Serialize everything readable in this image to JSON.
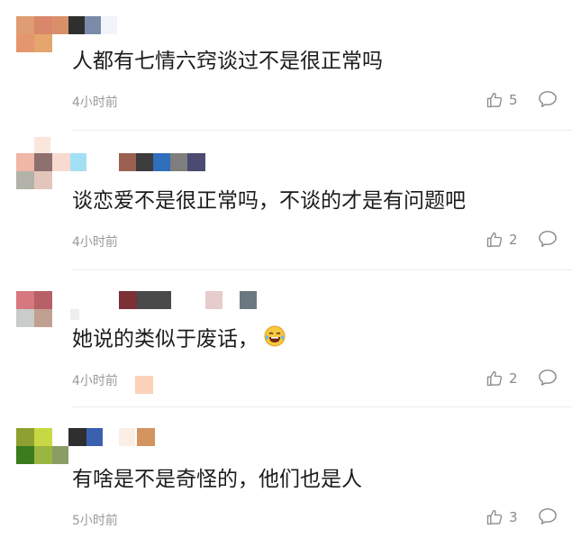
{
  "comments": [
    {
      "text": "人都有七情六窍谈过不是很正常吗",
      "time": "4小时前",
      "likes": "5"
    },
    {
      "text": "谈恋爱不是很正常吗，不谈的才是有问题吧",
      "time": "4小时前",
      "likes": "2"
    },
    {
      "text": "她说的类似于废话，",
      "emoji": "laughing-tears-emoji",
      "time": "4小时前",
      "likes": "2"
    },
    {
      "text": "有啥是不是奇怪的，他们也是人",
      "time": "5小时前",
      "likes": "3"
    }
  ],
  "icons": {
    "like": "thumbs-up-icon",
    "reply": "comment-bubble-icon"
  },
  "colors": {
    "text": "#1c1c1c",
    "meta": "#9a9a9a",
    "divider": "#ececec"
  }
}
